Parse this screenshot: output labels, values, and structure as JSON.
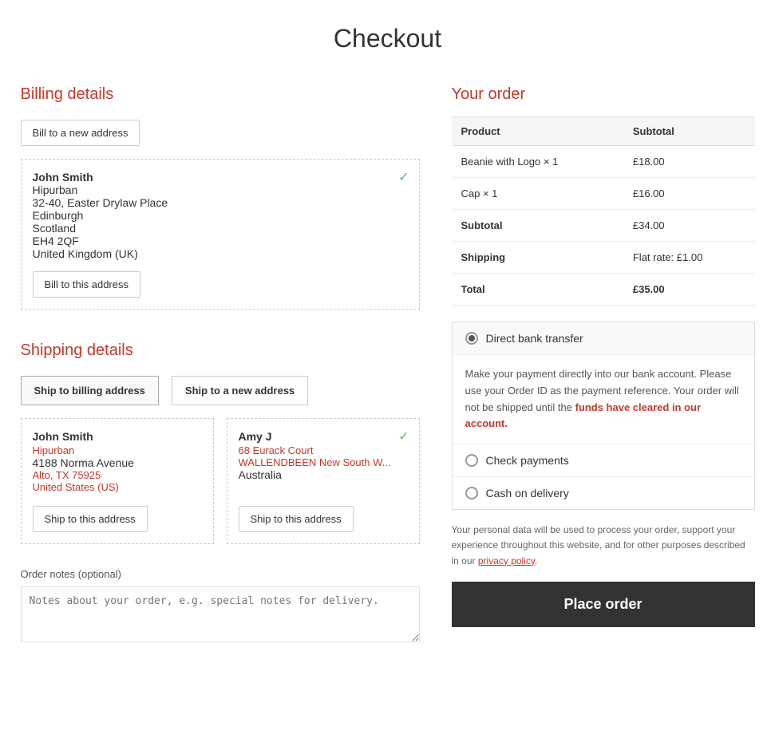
{
  "page": {
    "title": "Checkout"
  },
  "billing": {
    "section_title": "Billing details",
    "new_address_btn": "Bill to a new address",
    "address": {
      "name": "John Smith",
      "company": "Hipurban",
      "street": "32-40, Easter Drylaw Place",
      "city": "Edinburgh",
      "region": "Scotland",
      "postcode": "EH4 2QF",
      "country": "United Kingdom (UK)"
    },
    "bill_btn": "Bill to this address"
  },
  "shipping": {
    "section_title": "Shipping details",
    "tab_billing": "Ship to billing address",
    "tab_new": "Ship to a new address",
    "addresses": [
      {
        "name": "John Smith",
        "company": "Hipurban",
        "street": "4188 Norma Avenue",
        "city": "Alto, TX 75925",
        "country": "United States (US)",
        "selected": false,
        "btn": "Ship to this address"
      },
      {
        "name": "Amy J",
        "street": "68 Eurack Court",
        "city": "WALLENDBEEN New South W...",
        "country": "Australia",
        "selected": true,
        "btn": "Ship to this address"
      }
    ]
  },
  "order_notes": {
    "label": "Order notes (optional)",
    "placeholder": "Notes about your order, e.g. special notes for delivery."
  },
  "your_order": {
    "title": "Your order",
    "columns": [
      "Product",
      "Subtotal"
    ],
    "items": [
      {
        "product": "Beanie with Logo × 1",
        "subtotal": "£18.00"
      },
      {
        "product": "Cap × 1",
        "subtotal": "£16.00"
      }
    ],
    "subtotal_label": "Subtotal",
    "subtotal_value": "£34.00",
    "shipping_label": "Shipping",
    "shipping_value": "Flat rate: £1.00",
    "total_label": "Total",
    "total_value": "£35.00"
  },
  "payment": {
    "options": [
      {
        "id": "direct-bank",
        "label": "Direct bank transfer",
        "active": true
      },
      {
        "id": "check",
        "label": "Check payments",
        "active": false
      },
      {
        "id": "cod",
        "label": "Cash on delivery",
        "active": false
      }
    ],
    "description": "Make your payment directly into our bank account. Please use your Order ID as the payment reference. Your order will not be shipped until the funds have cleared in our account.",
    "description_highlight": "Make your payment directly into our bank account. Please use your Order ID as the payment reference. Your order will not be shipped until the funds have cleared in our account."
  },
  "privacy": {
    "text": "Your personal data will be used to process your order, support your experience throughout this website, and for other purposes described in our ",
    "link_text": "privacy policy",
    "text_end": "."
  },
  "place_order": {
    "label": "Place order"
  }
}
